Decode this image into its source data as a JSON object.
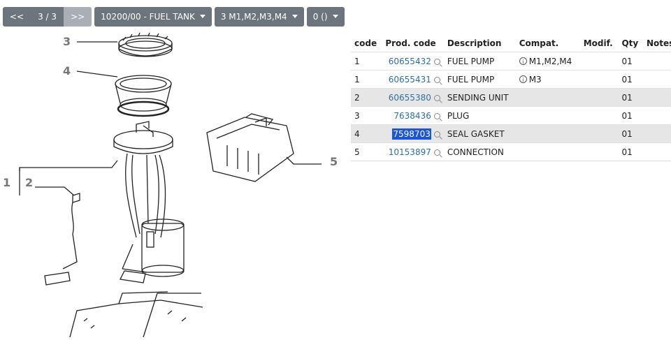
{
  "toolbar": {
    "prev_label": "<<",
    "page_indicator": "3 / 3",
    "next_label": ">>",
    "group_dropdown": "10200/00 - FUEL TANK",
    "variant_dropdown": "3 M1,M2,M3,M4",
    "filter_dropdown": "0 ()"
  },
  "diagram": {
    "callouts": [
      "3",
      "4",
      "1",
      "2",
      "5"
    ]
  },
  "table": {
    "headers": [
      "code",
      "Prod. code",
      "Description",
      "Compat.",
      "Modif.",
      "Qty",
      "Notes"
    ],
    "rows": [
      {
        "code": "1",
        "prod": "60655432",
        "desc": "FUEL PUMP",
        "compat": "M1,M2,M4",
        "qty": "01"
      },
      {
        "code": "1",
        "prod": "60655431",
        "desc": "FUEL PUMP",
        "compat": "M3",
        "qty": "01"
      },
      {
        "code": "2",
        "prod": "60655380",
        "desc": "SENDING UNIT",
        "compat": "",
        "qty": "01"
      },
      {
        "code": "3",
        "prod": "7638436",
        "desc": "PLUG",
        "compat": "",
        "qty": "01"
      },
      {
        "code": "4",
        "prod": "7598703",
        "desc": "SEAL GASKET",
        "compat": "",
        "qty": "01"
      },
      {
        "code": "5",
        "prod": "10153897",
        "desc": "CONNECTION",
        "compat": "",
        "qty": "01"
      }
    ],
    "info_glyph": "i"
  },
  "colors": {
    "button_bg": "#6c757d",
    "link": "#2f6fa7",
    "selection": "#1a56d6",
    "row_shade": "#e6e6e6"
  }
}
